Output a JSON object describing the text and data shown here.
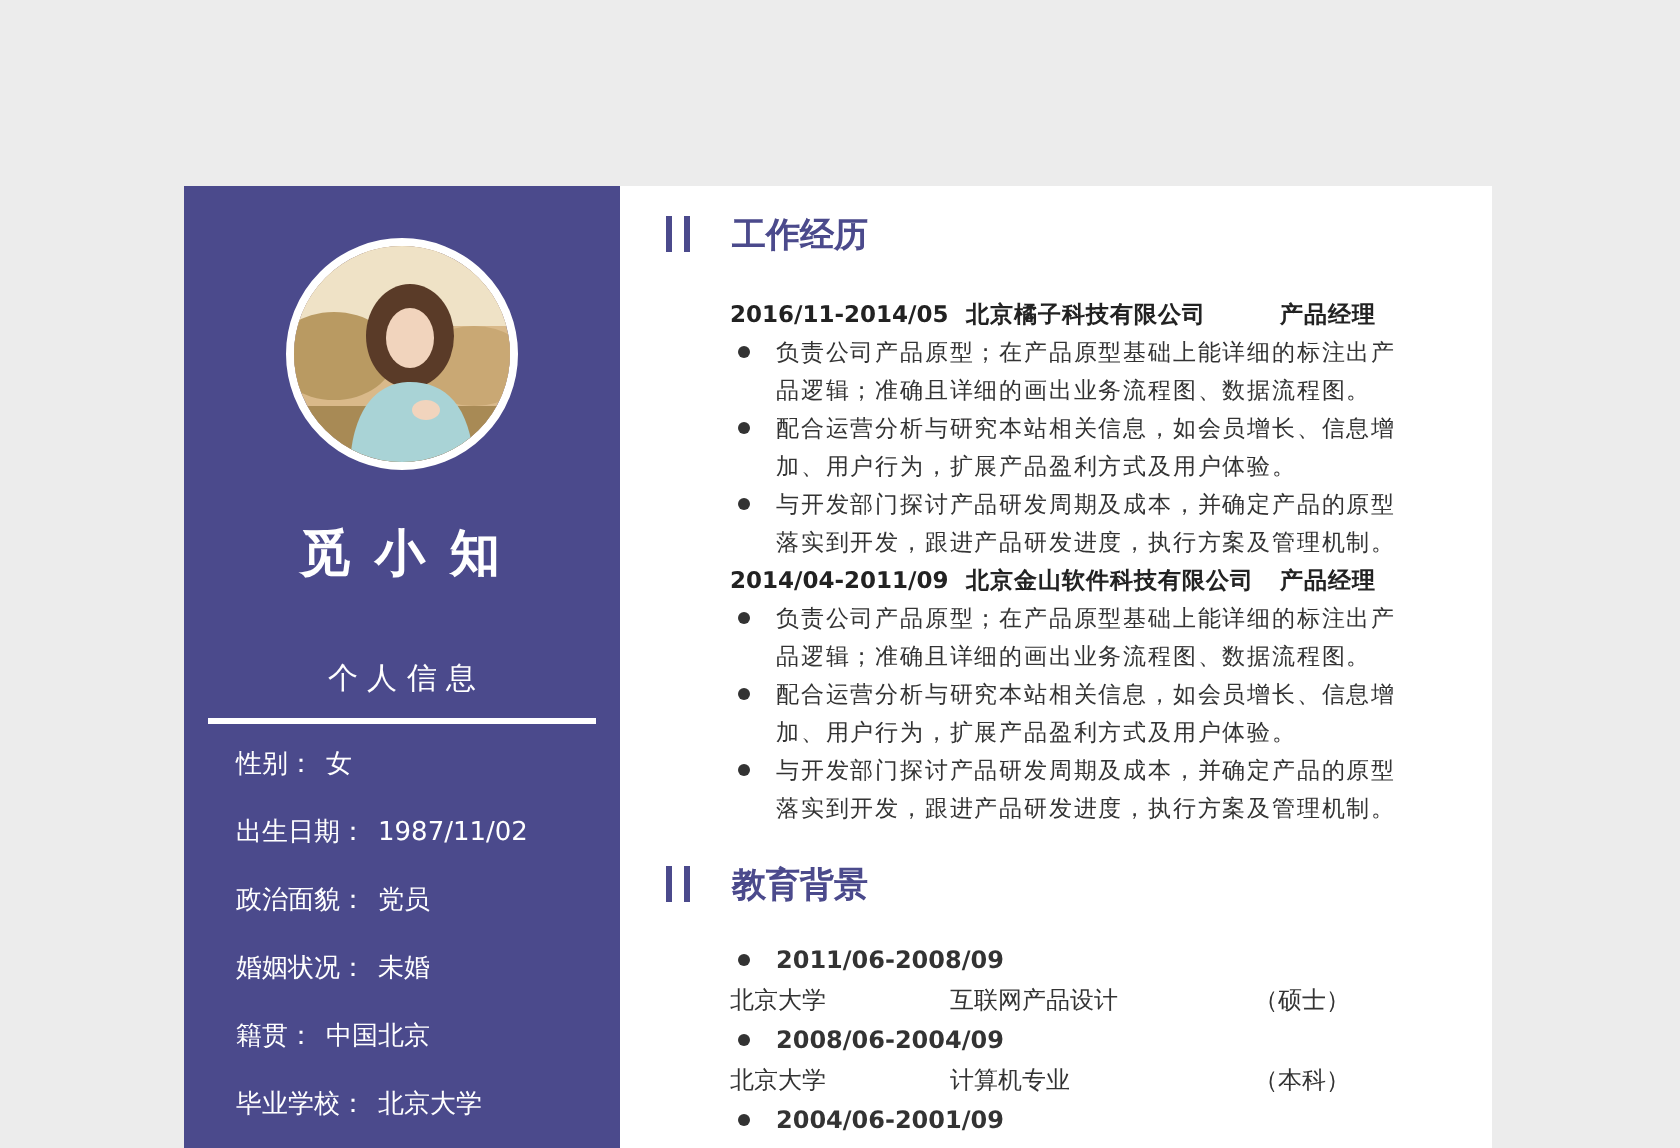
{
  "profile": {
    "name": "觅 小 知",
    "section_title": "个 人 信 息",
    "info": [
      {
        "label": "性别：",
        "value": "女"
      },
      {
        "label": "出生日期：",
        "value": "1987/11/02"
      },
      {
        "label": "政治面貌：",
        "value": "党员"
      },
      {
        "label": "婚姻状况：",
        "value": "未婚"
      },
      {
        "label": "籍贯：",
        "value": "中国北京"
      },
      {
        "label": "毕业学校：",
        "value": "北京大学"
      }
    ]
  },
  "work": {
    "title": "工作经历",
    "jobs": [
      {
        "period": "2016/11-2014/05",
        "company": "北京橘子科技有限公司",
        "role": "产品经理",
        "duties": [
          "负责公司产品原型；在产品原型基础上能详细的标注出产品逻辑；准确且详细的画出业务流程图、数据流程图。",
          "配合运营分析与研究本站相关信息，如会员增长、信息增加、用户行为，扩展产品盈利方式及用户体验。",
          "与开发部门探讨产品研发周期及成本，并确定产品的原型落实到开发，跟进产品研发进度，执行方案及管理机制。"
        ]
      },
      {
        "period": "2014/04-2011/09",
        "company": "北京金山软件科技有限公司",
        "role": "产品经理",
        "duties": [
          "负责公司产品原型；在产品原型基础上能详细的标注出产品逻辑；准确且详细的画出业务流程图、数据流程图。",
          "配合运营分析与研究本站相关信息，如会员增长、信息增加、用户行为，扩展产品盈利方式及用户体验。",
          "与开发部门探讨产品研发周期及成本，并确定产品的原型落实到开发，跟进产品研发进度，执行方案及管理机制。"
        ]
      }
    ]
  },
  "education": {
    "title": "教育背景",
    "items": [
      {
        "period": "2011/06-2008/09",
        "school": "北京大学",
        "major": "互联网产品设计",
        "degree": "（硕士）"
      },
      {
        "period": "2008/06-2004/09",
        "school": "北京大学",
        "major": "计算机专业",
        "degree": "（本科）"
      },
      {
        "period": "2004/06-2001/09"
      }
    ]
  }
}
